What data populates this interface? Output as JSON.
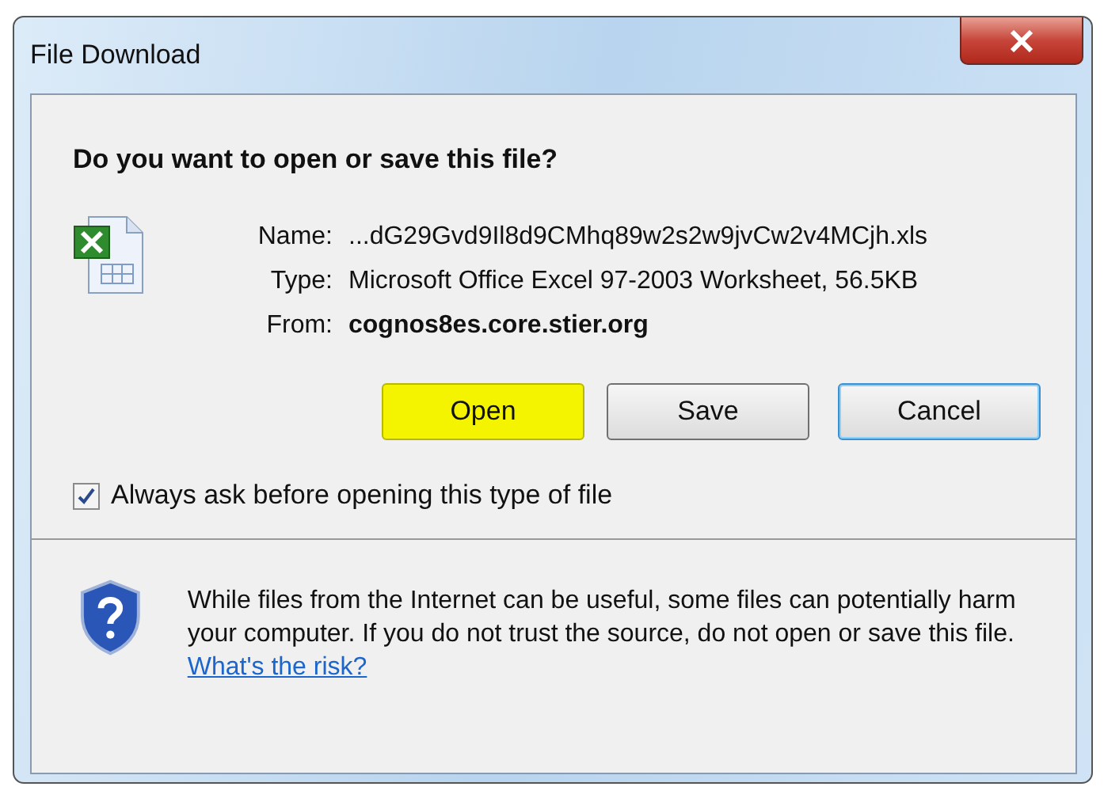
{
  "window": {
    "title": "File Download"
  },
  "heading": "Do you want to open or save this file?",
  "file_info": [
    {
      "label": "Name:",
      "value": "...dG29Gvd9Il8d9CMhq89w2s2w9jvCw2v4MCjh.xls",
      "bold": false
    },
    {
      "label": "Type:",
      "value": "Microsoft Office Excel 97-2003 Worksheet, 56.5KB",
      "bold": false
    },
    {
      "label": "From:",
      "value": "cognos8es.core.stier.org",
      "bold": true
    }
  ],
  "buttons": [
    {
      "label": "Open",
      "highlighted": true,
      "focused": false
    },
    {
      "label": "Save",
      "highlighted": false,
      "focused": false
    },
    {
      "label": "Cancel",
      "highlighted": false,
      "focused": true
    }
  ],
  "always_ask": {
    "label": "Always ask before opening this type of file",
    "checked": true
  },
  "warning": {
    "text": "While files from the Internet can be useful, some files can potentially harm your computer. If you do not trust the source, do not open or save this file.",
    "link": "What's the risk?"
  }
}
